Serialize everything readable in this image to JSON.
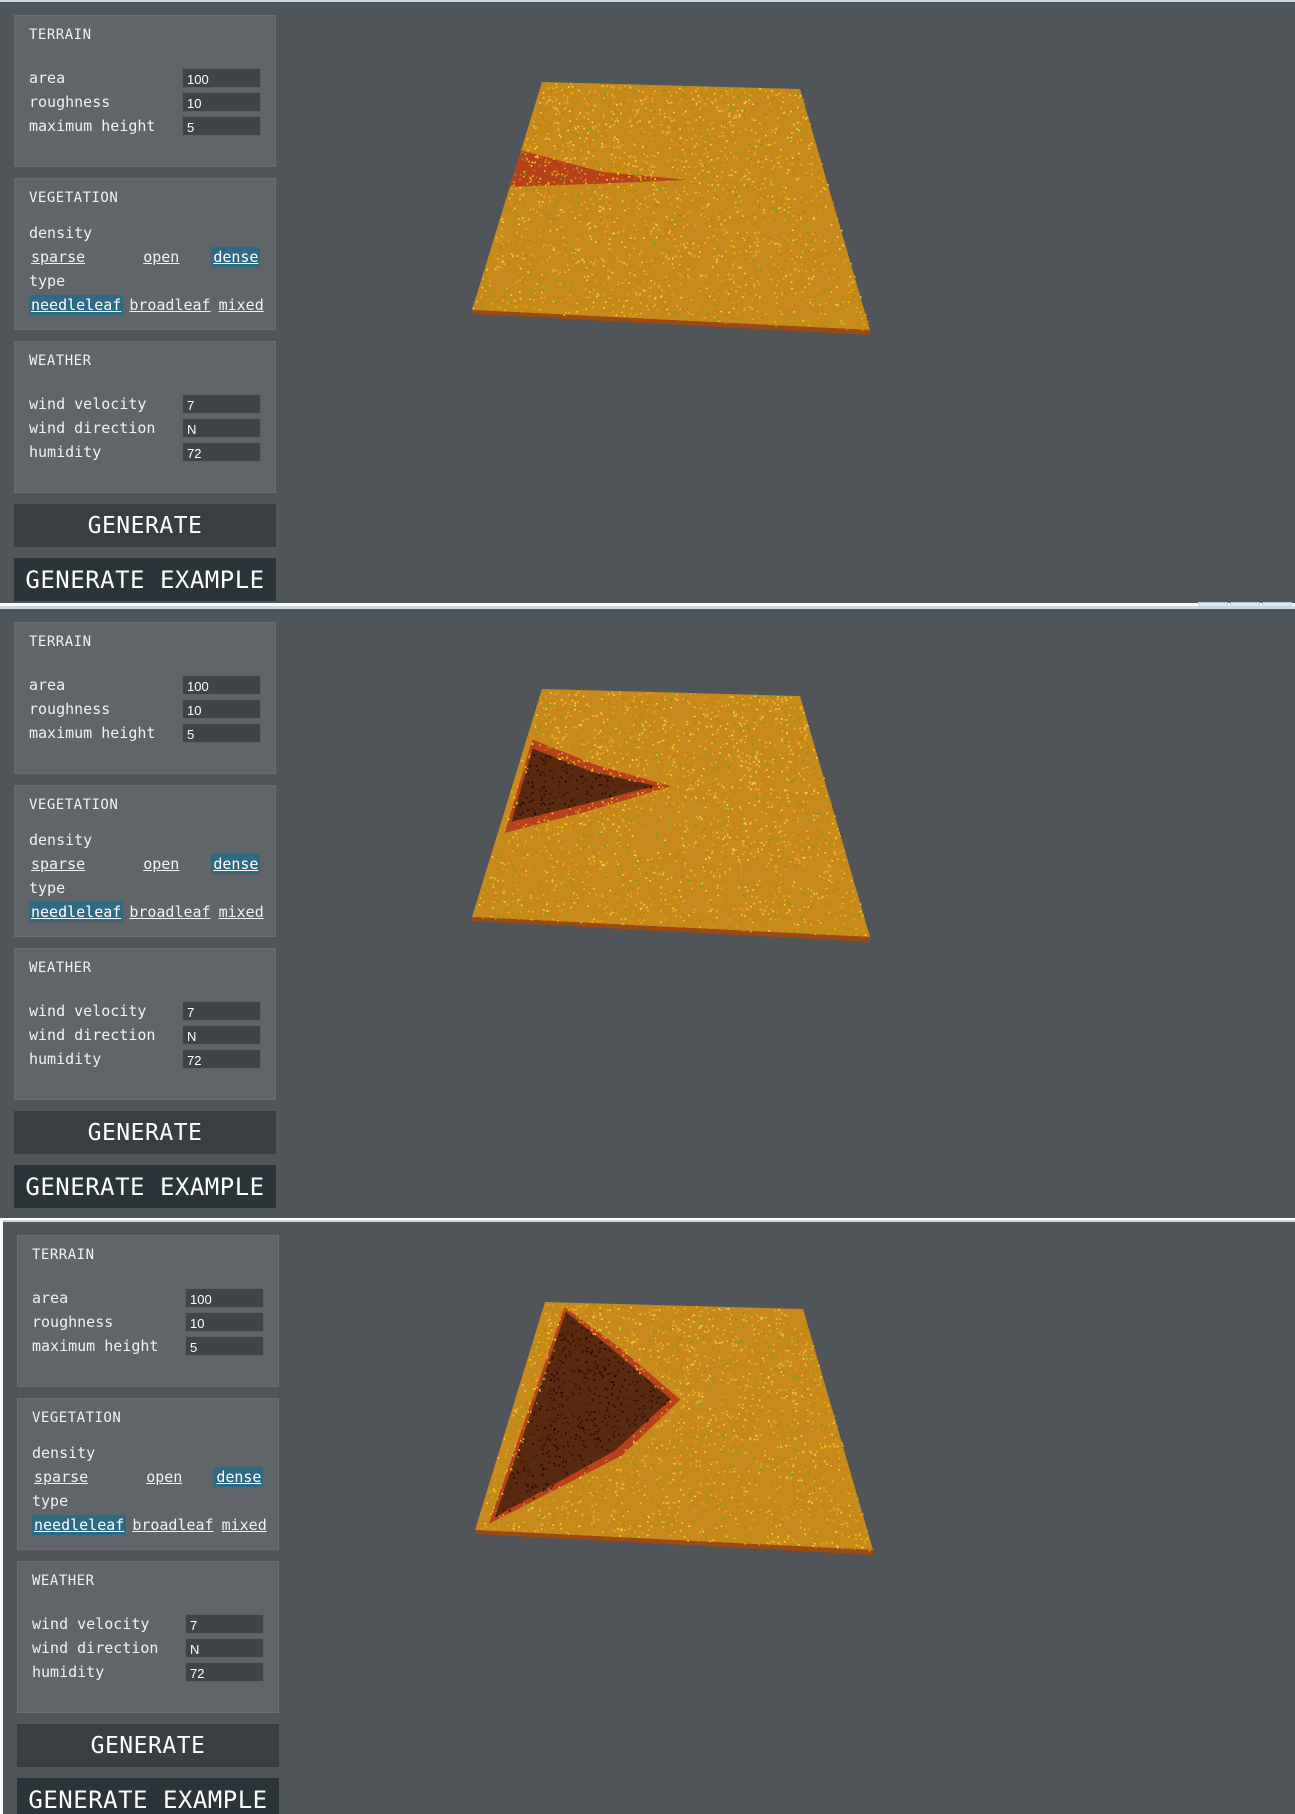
{
  "frames": [
    {
      "terrain": {
        "title": "TERRAIN",
        "fields": [
          {
            "label": "area",
            "value": "100"
          },
          {
            "label": "roughness",
            "value": "10"
          },
          {
            "label": "maximum height",
            "value": "5"
          }
        ]
      },
      "vegetation": {
        "title": "VEGETATION",
        "density_label": "density",
        "density_options": [
          "sparse",
          "open",
          "dense"
        ],
        "density_selected": "dense",
        "type_label": "type",
        "type_options": [
          "needleleaf",
          "broadleaf",
          "mixed"
        ],
        "type_selected": "needleleaf"
      },
      "weather": {
        "title": "WEATHER",
        "fields": [
          {
            "label": "wind velocity",
            "value": "7"
          },
          {
            "label": "wind direction",
            "value": "N"
          },
          {
            "label": "humidity",
            "value": "72"
          }
        ]
      },
      "buttons": {
        "generate": "GENERATE",
        "generate_example": "GENERATE EXAMPLE"
      },
      "burn_stage": 1
    },
    {
      "terrain": {
        "title": "TERRAIN",
        "fields": [
          {
            "label": "area",
            "value": "100"
          },
          {
            "label": "roughness",
            "value": "10"
          },
          {
            "label": "maximum height",
            "value": "5"
          }
        ]
      },
      "vegetation": {
        "title": "VEGETATION",
        "density_label": "density",
        "density_options": [
          "sparse",
          "open",
          "dense"
        ],
        "density_selected": "dense",
        "type_label": "type",
        "type_options": [
          "needleleaf",
          "broadleaf",
          "mixed"
        ],
        "type_selected": "needleleaf"
      },
      "weather": {
        "title": "WEATHER",
        "fields": [
          {
            "label": "wind velocity",
            "value": "7"
          },
          {
            "label": "wind direction",
            "value": "N"
          },
          {
            "label": "humidity",
            "value": "72"
          }
        ]
      },
      "buttons": {
        "generate": "GENERATE",
        "generate_example": "GENERATE EXAMPLE"
      },
      "burn_stage": 2
    },
    {
      "terrain": {
        "title": "TERRAIN",
        "fields": [
          {
            "label": "area",
            "value": "100"
          },
          {
            "label": "roughness",
            "value": "10"
          },
          {
            "label": "maximum height",
            "value": "5"
          }
        ]
      },
      "vegetation": {
        "title": "VEGETATION",
        "density_label": "density",
        "density_options": [
          "sparse",
          "open",
          "dense"
        ],
        "density_selected": "dense",
        "type_label": "type",
        "type_options": [
          "needleleaf",
          "broadleaf",
          "mixed"
        ],
        "type_selected": "needleleaf"
      },
      "weather": {
        "title": "WEATHER",
        "fields": [
          {
            "label": "wind velocity",
            "value": "7"
          },
          {
            "label": "wind direction",
            "value": "N"
          },
          {
            "label": "humidity",
            "value": "72"
          }
        ]
      },
      "buttons": {
        "generate": "GENERATE",
        "generate_example": "GENERATE EXAMPLE"
      },
      "burn_stage": 3
    }
  ],
  "colors": {
    "background": "#4f5559",
    "panel": "#5f6569",
    "selected": "#2f6a84",
    "terrain_vegetation": "#c98a1c",
    "fire_front": "#b8401a",
    "burned": "#5a2a10"
  }
}
